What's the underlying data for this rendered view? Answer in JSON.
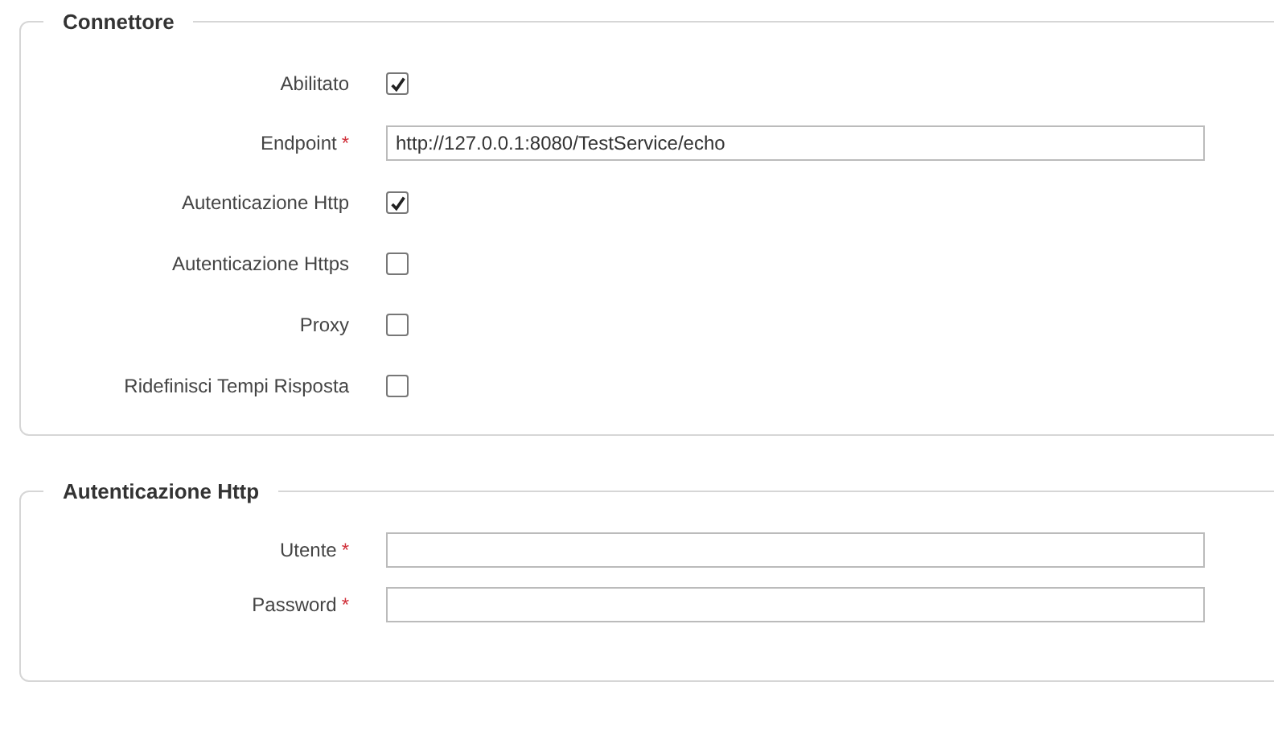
{
  "sections": [
    {
      "title": "Connettore",
      "fields": [
        {
          "kind": "checkbox",
          "label": "Abilitato",
          "checked": true
        },
        {
          "kind": "text",
          "label": "Endpoint",
          "required_mark": "*",
          "value": "http://127.0.0.1:8080/TestService/echo"
        },
        {
          "kind": "checkbox",
          "label": "Autenticazione Http",
          "checked": true
        },
        {
          "kind": "checkbox",
          "label": "Autenticazione Https",
          "checked": false
        },
        {
          "kind": "checkbox",
          "label": "Proxy",
          "checked": false
        },
        {
          "kind": "checkbox",
          "label": "Ridefinisci Tempi Risposta",
          "checked": false
        }
      ]
    },
    {
      "title": "Autenticazione Http",
      "fields": [
        {
          "kind": "text",
          "label": "Utente",
          "required_mark": "*"
        },
        {
          "kind": "text",
          "label": "Password",
          "required_mark": "*"
        }
      ]
    }
  ]
}
